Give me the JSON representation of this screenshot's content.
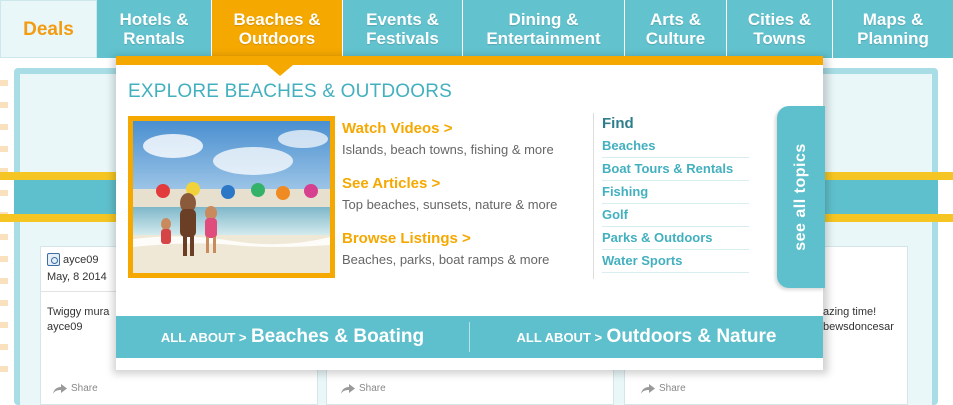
{
  "nav": {
    "items": [
      {
        "line1": "Deals",
        "line2": ""
      },
      {
        "line1": "Hotels &",
        "line2": "Rentals"
      },
      {
        "line1": "Beaches &",
        "line2": "Outdoors"
      },
      {
        "line1": "Events &",
        "line2": "Festivals"
      },
      {
        "line1": "Dining &",
        "line2": "Entertainment"
      },
      {
        "line1": "Arts &",
        "line2": "Culture"
      },
      {
        "line1": "Cities &",
        "line2": "Towns"
      },
      {
        "line1": "Maps &",
        "line2": "Planning"
      }
    ],
    "active_index": 2
  },
  "dropdown": {
    "title": "EXPLORE BEACHES & OUTDOORS",
    "features": [
      {
        "title": "Watch Videos >",
        "desc": "Islands, beach towns, fishing & more"
      },
      {
        "title": "See Articles >",
        "desc": "Top beaches, sunsets, nature & more"
      },
      {
        "title": "Browse Listings >",
        "desc": "Beaches, parks, boat ramps & more"
      }
    ],
    "find": {
      "heading": "Find",
      "links": [
        "Beaches",
        "Boat Tours & Rentals",
        "Fishing",
        "Golf",
        "Parks & Outdoors",
        "Water Sports"
      ]
    },
    "see_all": "see all topics",
    "bottom": [
      {
        "prefix": "ALL ABOUT >",
        "label": "Beaches & Boating"
      },
      {
        "prefix": "ALL ABOUT >",
        "label": "Outdoors & Nature"
      }
    ]
  },
  "cards": [
    {
      "user": "ayce09",
      "date": "May, 8 2014",
      "text_line1": "Twiggy mura",
      "text_line2": "ayce09",
      "share": "Share"
    },
    {
      "share": "Share"
    },
    {
      "text_line1": "azing time!",
      "text_line2": "bewsdoncesar",
      "share": "Share"
    }
  ],
  "colors": {
    "teal": "#5fc0cd",
    "orange": "#f5a800",
    "link_teal": "#43b0bf",
    "stripe_yellow": "#f5c623"
  },
  "icons": {
    "card_user": "instagram-icon",
    "share": "share-arrow-icon"
  }
}
